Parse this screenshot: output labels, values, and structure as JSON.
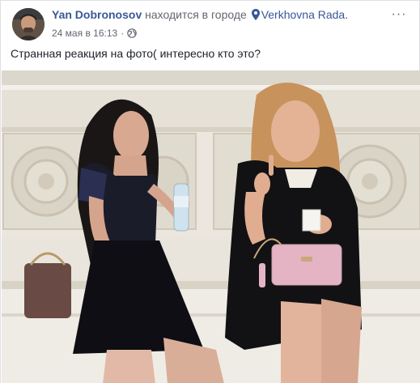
{
  "post": {
    "author": "Yan Dobronosov",
    "action_text": "находится в городе",
    "place": "Verkhovna Rada.",
    "date": "24 мая в 16:13",
    "separator": "·",
    "privacy_icon": "globe-icon",
    "location_icon": "pin-icon",
    "menu_icon": "more-options-icon",
    "menu_label": "···",
    "text": "Странная реакция на фото( интересно кто это?"
  },
  "colors": {
    "link_blue": "#385898",
    "text_primary": "#1d2129",
    "text_secondary": "#616770"
  }
}
